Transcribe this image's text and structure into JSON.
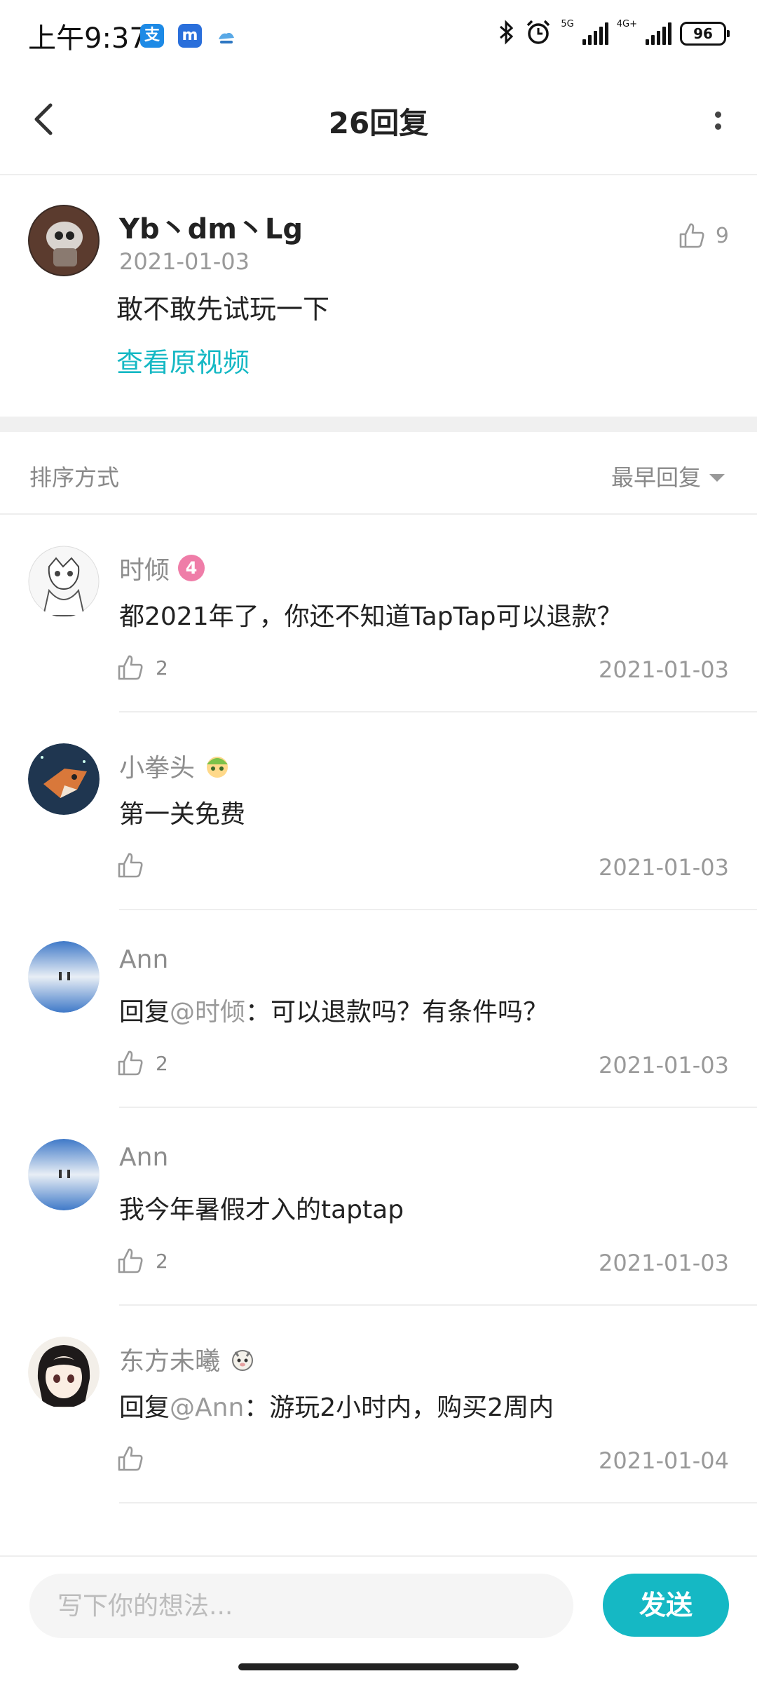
{
  "status_bar": {
    "time": "上午9:37",
    "net_5g": "5G",
    "net_4g": "4G+",
    "battery": "96"
  },
  "header": {
    "title": "26回复"
  },
  "post": {
    "author": "Yb丶dm丶Lg",
    "date": "2021-01-03",
    "likes": "9",
    "text": "敢不敢先试玩一下",
    "link_label": "查看原视频"
  },
  "sort": {
    "label": "排序方式",
    "value": "最早回复"
  },
  "replies": [
    {
      "name": "时倾",
      "level": "4",
      "text": "都2021年了，你还不知道TapTap可以退款？",
      "likes": "2",
      "date": "2021-01-03"
    },
    {
      "name": "小拳头",
      "text": "第一关免费",
      "likes": "",
      "date": "2021-01-03"
    },
    {
      "name": "Ann",
      "reply_prefix": "回复",
      "mention": "@时倾",
      "text": "：可以退款吗？有条件吗？",
      "likes": "2",
      "date": "2021-01-03"
    },
    {
      "name": "Ann",
      "text": "我今年暑假才入的taptap",
      "likes": "2",
      "date": "2021-01-03"
    },
    {
      "name": "东方未曦",
      "reply_prefix": "回复",
      "mention": "@Ann",
      "text": "：游玩2小时内，购买2周内",
      "likes": "",
      "date": "2021-01-04"
    }
  ],
  "composer": {
    "placeholder": "写下你的想法...",
    "send_label": "发送"
  },
  "colors": {
    "accent": "#15b8c4",
    "level_badge": "#ef7da8"
  }
}
